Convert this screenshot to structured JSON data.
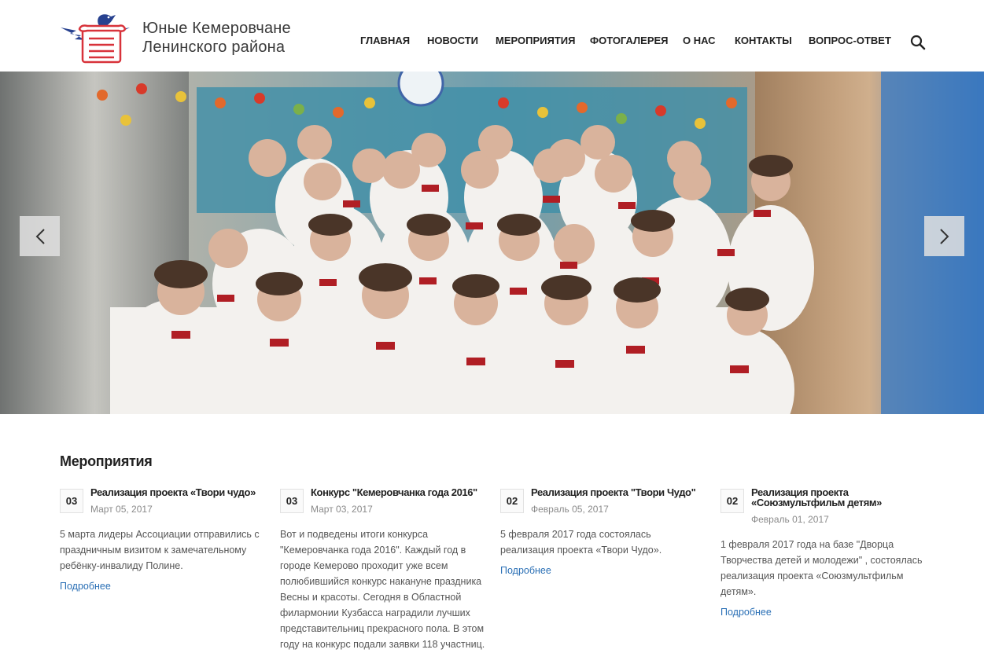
{
  "brand": {
    "line1": "Юные Кемеровчане",
    "line2": "Ленинского района",
    "colors": {
      "red": "#d8323a",
      "blue": "#27418f"
    }
  },
  "nav": {
    "items": [
      {
        "label": "ГЛАВНАЯ"
      },
      {
        "label": "НОВОСТИ"
      },
      {
        "label": "МЕРОПРИЯТИЯ"
      },
      {
        "label": "ФОТОГАЛЕРЕЯ"
      },
      {
        "label": "О НАС"
      },
      {
        "label": "КОНТАКТЫ"
      },
      {
        "label": "ВОПРОС-ОТВЕТ"
      }
    ],
    "search_icon": "search-icon"
  },
  "slider": {
    "image": "group-photo",
    "prev_icon": "chevron-left-icon",
    "next_icon": "chevron-right-icon"
  },
  "events": {
    "title": "Мероприятия",
    "more_label": "Подробнее",
    "items": [
      {
        "day": "03",
        "title": "Реализация проекта «Твори чудо»",
        "date": "Март 05, 2017",
        "text": "5 марта лидеры Ассоциации отправились с праздничным визитом к замечательному ребёнку-инвалиду Полине.",
        "more": "Подробнее"
      },
      {
        "day": "03",
        "title": "Конкурс \"Кемеровчанка года 2016\"",
        "date": "Март 03, 2017",
        "text": "Вот и подведены итоги конкурса \"Кемеровчанка года 2016\". Каждый год в городе Кемерово проходит уже всем полюбившийся конкурс накануне праздника Весны и красоты. Сегодня в Областной филармонии Кузбасса наградили лучших представительниц прекрасного пола. В этом году на конкурс подали заявки 118 участниц.",
        "more": ""
      },
      {
        "day": "02",
        "title": "Реализация проекта \"Твори Чудо\"",
        "date": "Февраль 05, 2017",
        "text": "5 февраля 2017 года состоялась реализация проекта «Твори Чудо».",
        "more": "Подробнее"
      },
      {
        "day": "02",
        "title": "Реализация проекта «Союзмультфильм детям»",
        "date": "Февраль 01, 2017",
        "text": "1 февраля 2017 года на базе \"Дворца Творчества детей и молодежи\" , состоялась реализация проекта «Союзмультфильм детям».",
        "more": "Подробнее"
      }
    ]
  }
}
